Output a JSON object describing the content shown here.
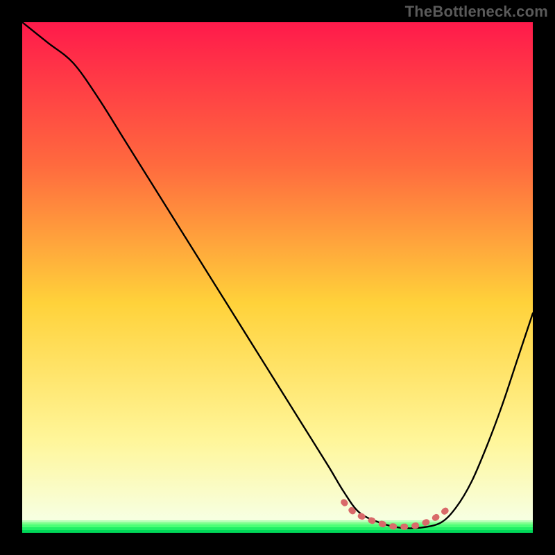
{
  "watermark": "TheBottleneck.com",
  "colors": {
    "gradient_top": "#ff1a4b",
    "gradient_mid_upper": "#ff6a3e",
    "gradient_mid": "#ffd23a",
    "gradient_lower": "#fff69a",
    "gradient_bottom": "#f7ffe0",
    "green_band_top": "#6dff6d",
    "green_band_mid": "#2dff6a",
    "green_band_bottom": "#00e05a",
    "curve": "#000000",
    "marker": "#d96a6a",
    "frame_bg": "#000000"
  },
  "chart_data": {
    "type": "line",
    "title": "",
    "xlabel": "",
    "ylabel": "",
    "xlim": [
      0,
      100
    ],
    "ylim": [
      0,
      100
    ],
    "grid": false,
    "legend": false,
    "series": [
      {
        "name": "bottleneck-curve",
        "x": [
          0,
          5,
          10,
          15,
          20,
          25,
          30,
          35,
          40,
          45,
          50,
          55,
          60,
          63,
          66,
          70,
          74,
          78,
          82,
          85,
          88,
          91,
          94,
          97,
          100
        ],
        "y": [
          100,
          96,
          92,
          85,
          77,
          69,
          61,
          53,
          45,
          37,
          29,
          21,
          13,
          8,
          4,
          2,
          1,
          1,
          2,
          5,
          10,
          17,
          25,
          34,
          43
        ]
      }
    ],
    "markers": {
      "name": "optimal-range",
      "x": [
        63,
        65,
        67,
        69,
        71,
        73,
        75,
        77,
        79,
        81,
        83
      ],
      "y": [
        6,
        4,
        3,
        2.2,
        1.6,
        1.2,
        1.2,
        1.4,
        2.0,
        3.0,
        4.4
      ]
    }
  }
}
